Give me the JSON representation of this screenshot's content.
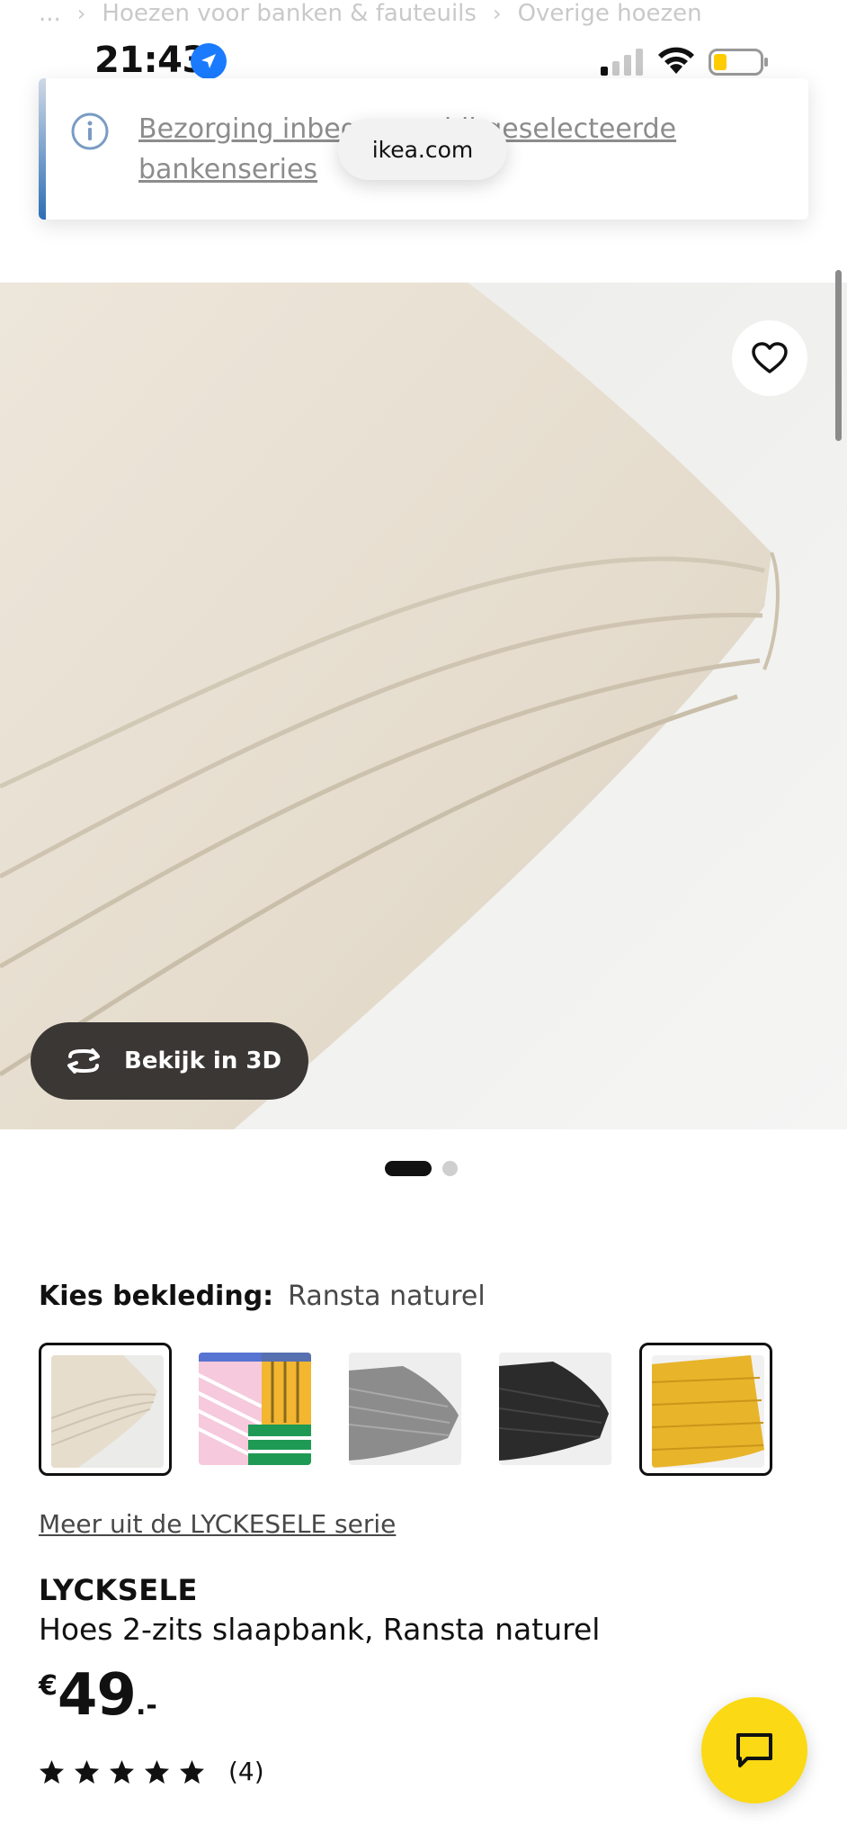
{
  "breadcrumb": {
    "items": [
      "...",
      "Hoezen voor banken & fauteuils",
      "Overige hoezen"
    ],
    "separator": "›"
  },
  "status_bar": {
    "time": "21:43",
    "location_icon": "location-arrow-icon",
    "signal_icon": "cellular-signal-icon",
    "wifi_icon": "wifi-icon",
    "battery_icon": "battery-low-icon"
  },
  "banner": {
    "text": "Bezorging inbegrepen bij geselecteerde bankenseries",
    "icon": "info-icon",
    "accent_color": "#2d6fb6"
  },
  "browser": {
    "url": "ikea.com"
  },
  "hero": {
    "favorite_icon": "heart-icon",
    "view3d_label": "Bekijk in 3D",
    "view3d_icon": "rotate-3d-icon",
    "image_count": 2,
    "active_image": 1
  },
  "variant": {
    "label": "Kies bekleding:",
    "selected_value": "Ransta naturel",
    "swatches": [
      {
        "name": "ransta-naturel",
        "selected": true
      },
      {
        "name": "pink-yellow-green-pattern",
        "selected": false
      },
      {
        "name": "grey",
        "selected": false
      },
      {
        "name": "black",
        "selected": false
      },
      {
        "name": "yellow",
        "selected": false
      }
    ]
  },
  "product": {
    "series_link": "Meer uit de LYCKESELE serie",
    "name": "LYCKSELE",
    "description": "Hoes 2-zits slaapbank, Ransta naturel",
    "price_currency": "€",
    "price_integer": "49",
    "price_decimal": ".-",
    "rating_stars": 5,
    "rating_count": "(4)"
  },
  "chat": {
    "icon": "chat-bubble-icon",
    "color": "#fbd914"
  }
}
